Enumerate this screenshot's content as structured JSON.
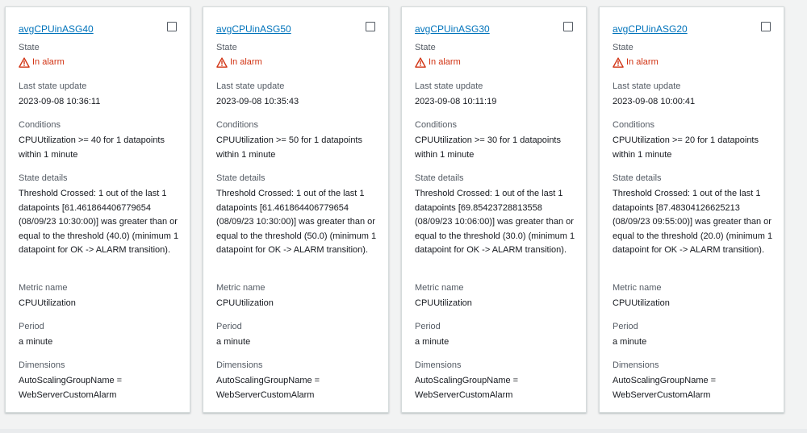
{
  "labels": {
    "state": "State",
    "last_state_update": "Last state update",
    "conditions": "Conditions",
    "state_details": "State details",
    "metric_name": "Metric name",
    "period": "Period",
    "dimensions": "Dimensions"
  },
  "colors": {
    "link": "#0073bb",
    "alarm": "#d13212",
    "card_border": "#d5dbdb",
    "background": "#f2f3f3"
  },
  "icons": {
    "state": "warning-triangle-icon",
    "select": "checkbox"
  },
  "cards": [
    {
      "name": "avgCPUinASG40",
      "state": "In alarm",
      "last_state_update": "2023-09-08 10:36:11",
      "conditions": "CPUUtilization >= 40 for 1 datapoints within 1 minute",
      "state_details": "Threshold Crossed: 1 out of the last 1 datapoints [61.461864406779654 (08/09/23 10:30:00)] was greater than or equal to the threshold (40.0) (minimum 1 datapoint for OK -> ALARM transition).",
      "metric_name": "CPUUtilization",
      "period": "a minute",
      "dimensions": "AutoScalingGroupName = WebServerCustomAlarm"
    },
    {
      "name": "avgCPUinASG50",
      "state": "In alarm",
      "last_state_update": "2023-09-08 10:35:43",
      "conditions": "CPUUtilization >= 50 for 1 datapoints within 1 minute",
      "state_details": "Threshold Crossed: 1 out of the last 1 datapoints [61.461864406779654 (08/09/23 10:30:00)] was greater than or equal to the threshold (50.0) (minimum 1 datapoint for OK -> ALARM transition).",
      "metric_name": "CPUUtilization",
      "period": "a minute",
      "dimensions": "AutoScalingGroupName = WebServerCustomAlarm"
    },
    {
      "name": "avgCPUinASG30",
      "state": "In alarm",
      "last_state_update": "2023-09-08 10:11:19",
      "conditions": "CPUUtilization >= 30 for 1 datapoints within 1 minute",
      "state_details": "Threshold Crossed: 1 out of the last 1 datapoints [69.85423728813558 (08/09/23 10:06:00)] was greater than or equal to the threshold (30.0) (minimum 1 datapoint for OK -> ALARM transition).",
      "metric_name": "CPUUtilization",
      "period": "a minute",
      "dimensions": "AutoScalingGroupName = WebServerCustomAlarm"
    },
    {
      "name": "avgCPUinASG20",
      "state": "In alarm",
      "last_state_update": "2023-09-08 10:00:41",
      "conditions": "CPUUtilization >= 20 for 1 datapoints within 1 minute",
      "state_details": "Threshold Crossed: 1 out of the last 1 datapoints [87.48304126625213 (08/09/23 09:55:00)] was greater than or equal to the threshold (20.0) (minimum 1 datapoint for OK -> ALARM transition).",
      "metric_name": "CPUUtilization",
      "period": "a minute",
      "dimensions": "AutoScalingGroupName = WebServerCustomAlarm"
    }
  ]
}
